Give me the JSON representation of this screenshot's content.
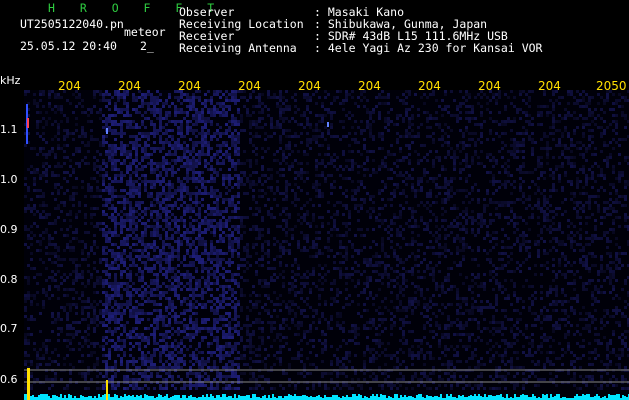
{
  "header": {
    "app_name": "H R O F F T",
    "filename": "UT2505122040.pn",
    "tag": "meteor",
    "datetime": "25.05.12 20:40",
    "counter": "2_",
    "info_labels": [
      "Observer",
      "Receiving Location",
      "Receiver",
      "Receiving Antenna"
    ],
    "info_values": [
      ": Masaki Kano",
      ": Shibukawa, Gunma, Japan",
      ": SDR# 43dB L15 111.6MHz USB",
      ": 4ele Yagi Az 230 for Kansai VOR"
    ]
  },
  "y_axis": {
    "unit": "kHz",
    "ticks": [
      "1.1",
      "1.0",
      "0.9",
      "0.8",
      "0.7",
      "0.6"
    ]
  },
  "x_axis": {
    "ticks": [
      "204",
      "204",
      "204",
      "204",
      "204",
      "204",
      "204",
      "204",
      "204",
      "2050"
    ]
  },
  "colors": {
    "background": "#000000",
    "title_green": "#2ecc40",
    "tick_yellow": "#ffd700",
    "signal_cyan": "#00e5ff"
  }
}
